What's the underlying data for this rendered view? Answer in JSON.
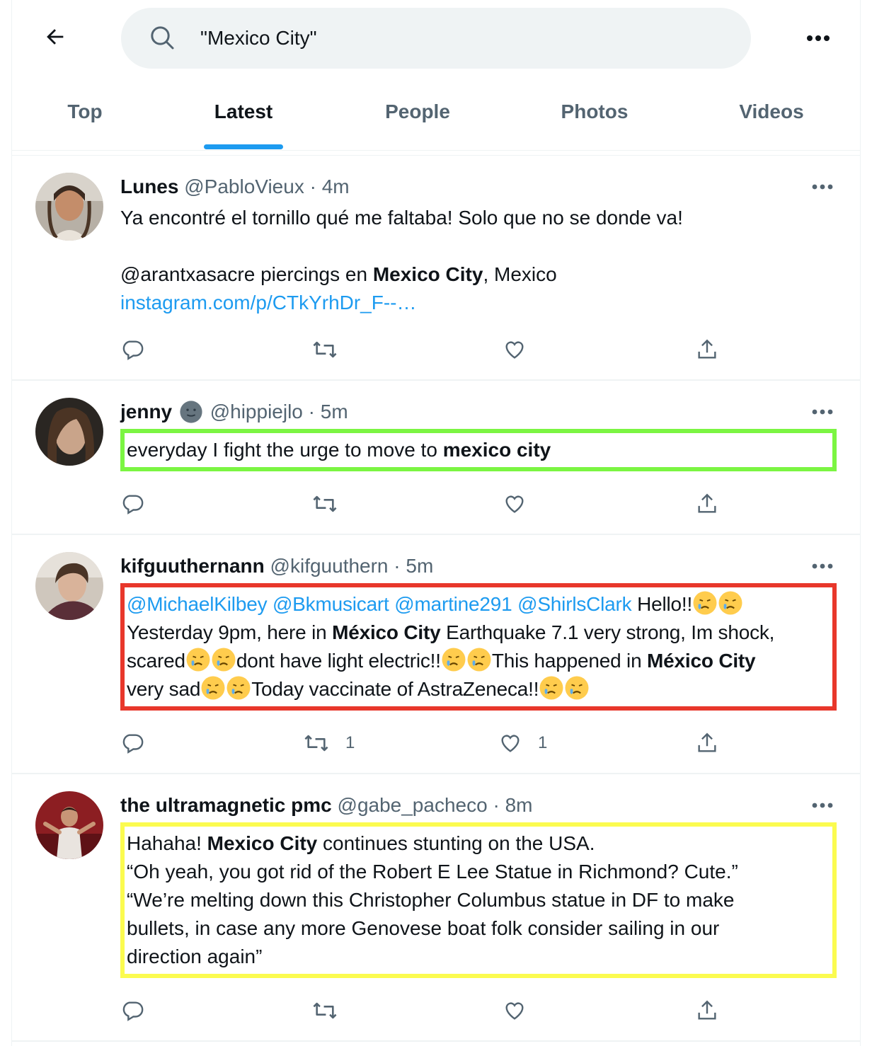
{
  "search": {
    "query": "\"Mexico City\""
  },
  "tabs": [
    {
      "label": "Top"
    },
    {
      "label": "Latest"
    },
    {
      "label": "People"
    },
    {
      "label": "Photos"
    },
    {
      "label": "Videos"
    }
  ],
  "tweets": [
    {
      "name": "Lunes",
      "handle": "@PabloVieux",
      "dot": "·",
      "time": "4m",
      "line1": "Ya encontré el tornillo qué me faltaba!  Solo que no se donde va!",
      "line2_pre": "@arantxasacre piercings en ",
      "line2_bold": "Mexico City",
      "line2_post": ", Mexico",
      "link": "instagram.com/p/CTkYrhDr_F--…"
    },
    {
      "name": "jenny",
      "handle": "@hippiejlo",
      "dot": "·",
      "time": "5m",
      "text_pre": "everyday I fight the urge to move to ",
      "text_bold": "mexico city"
    },
    {
      "name": "kifguuthernann",
      "handle": "@kifguuthern",
      "dot": "·",
      "time": "5m",
      "mentions": "@MichaelKilbey @Bkmusicart @martine291 @ShirlsClark",
      "hello": " Hello!!",
      "l2_pre": "Yesterday 9pm, here in ",
      "l2_bold": "México City",
      "l2_post": " Earthquake 7.1 very strong, Im shock,",
      "l3_pre": "scared",
      "l3_mid": "dont have light electric!!",
      "l3_post": "This happened in ",
      "l3_bold": "México City",
      "l4_pre": "very sad",
      "l4_post": "Today vaccinate of AstraZeneca!!",
      "retweets": "1",
      "likes": "1"
    },
    {
      "name": "the ultramagnetic pmc",
      "handle": "@gabe_pacheco",
      "dot": "·",
      "time": "8m",
      "l1_pre": "Hahaha! ",
      "l1_bold": "Mexico City",
      "l1_post": " continues stunting on the USA.",
      "l2": "“Oh yeah, you got rid of the Robert E Lee Statue in Richmond? Cute.”",
      "l3": "“We’re melting down this Christopher Columbus statue in DF to make",
      "l4": "bullets, in case any more Genovese boat folk consider sailing in our",
      "l5": "direction again”"
    }
  ],
  "colors": {
    "accent": "#1d9bf0",
    "highlight_green": "#7bf542",
    "highlight_red": "#e8372b",
    "highlight_yellow": "#fbfb4f"
  }
}
